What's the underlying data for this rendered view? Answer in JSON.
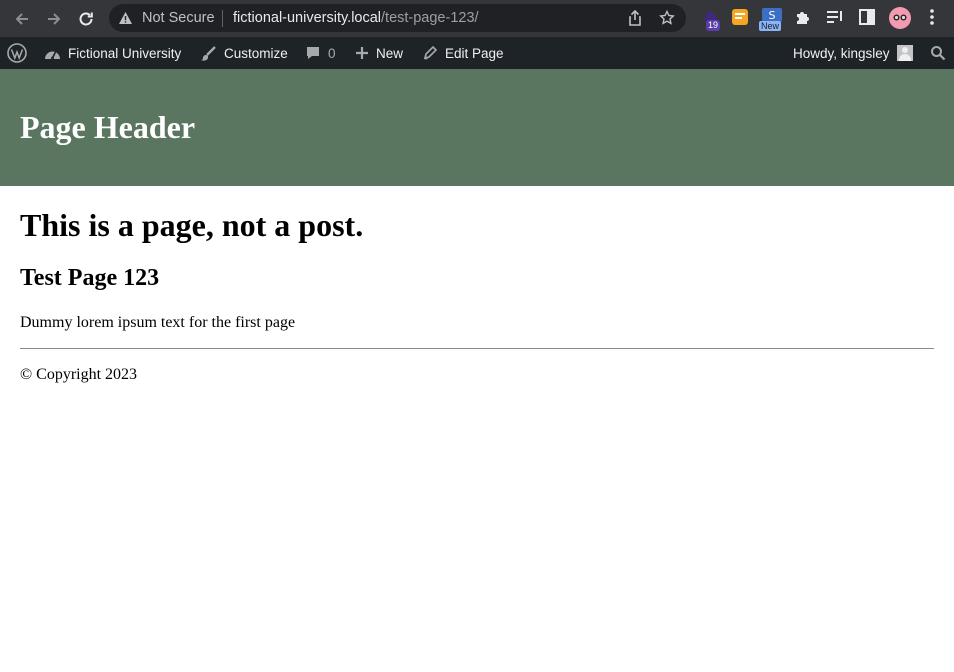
{
  "browser": {
    "security_label": "Not Secure",
    "url_host": "fictional-university.local",
    "url_path": "/test-page-123/",
    "extension_badge_count": "19",
    "extension_new_badge": "New"
  },
  "admin_bar": {
    "site_name": "Fictional University",
    "customize": "Customize",
    "comments_count": "0",
    "new": "New",
    "edit_page": "Edit Page",
    "greeting": "Howdy, kingsley"
  },
  "header": {
    "title": "Page Header"
  },
  "content": {
    "page_notice": "This is a page, not a post.",
    "page_title": "Test Page 123",
    "body_text": "Dummy lorem ipsum text for the first page",
    "copyright": "© Copyright 2023"
  },
  "colors": {
    "header_bg": "#5a7560",
    "admin_bar_bg": "#1d2327",
    "browser_bar_bg": "#35363a"
  }
}
